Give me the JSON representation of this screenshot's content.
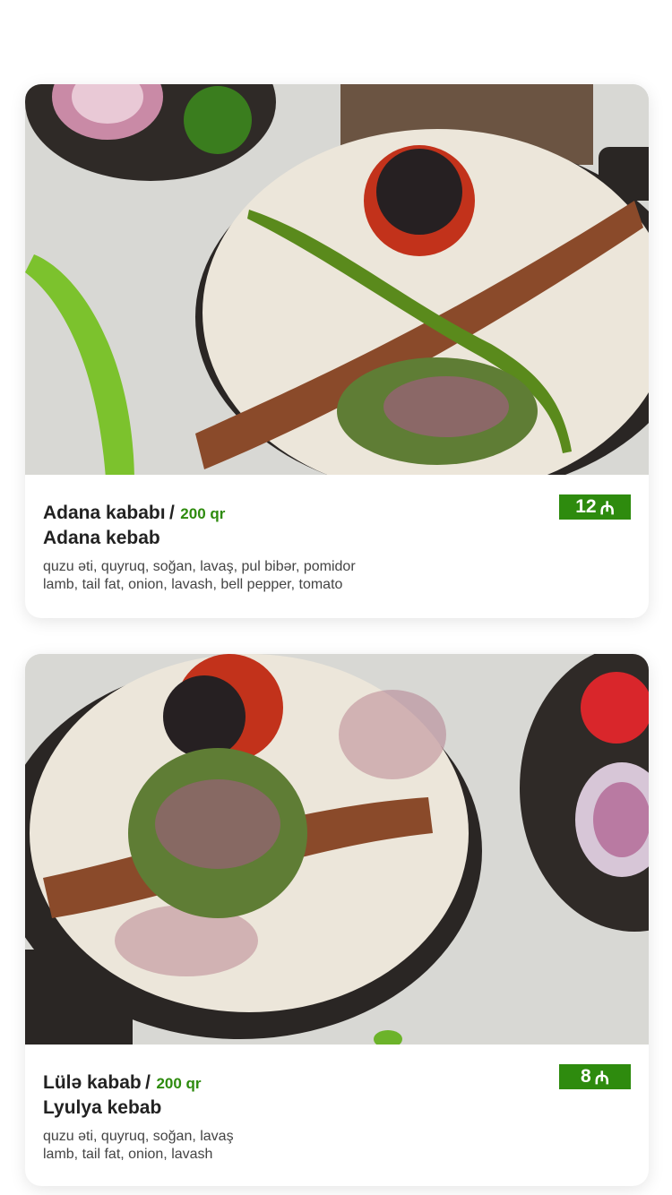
{
  "items": [
    {
      "name_az": "Adana kababı",
      "separator": "/",
      "weight": "200 qr",
      "name_en": "Adana kebab",
      "desc_az": "quzu əti, quyruq, soğan, lavaş, pul bibər, pomidor",
      "desc_en": "lamb, tail fat, onion, lavash, bell pepper, tomato",
      "price": "12",
      "currency_symbol": "₼"
    },
    {
      "name_az": "Lülə kabab",
      "separator": "/",
      "weight": "200 qr",
      "name_en": "Lyulya kebab",
      "desc_az": "quzu əti, quyruq, soğan, lavaş",
      "desc_en": "lamb, tail fat, onion, lavash",
      "price": "8",
      "currency_symbol": "₼"
    }
  ],
  "colors": {
    "accent": "#2e8b0e",
    "text": "#222222",
    "muted": "#444444"
  }
}
